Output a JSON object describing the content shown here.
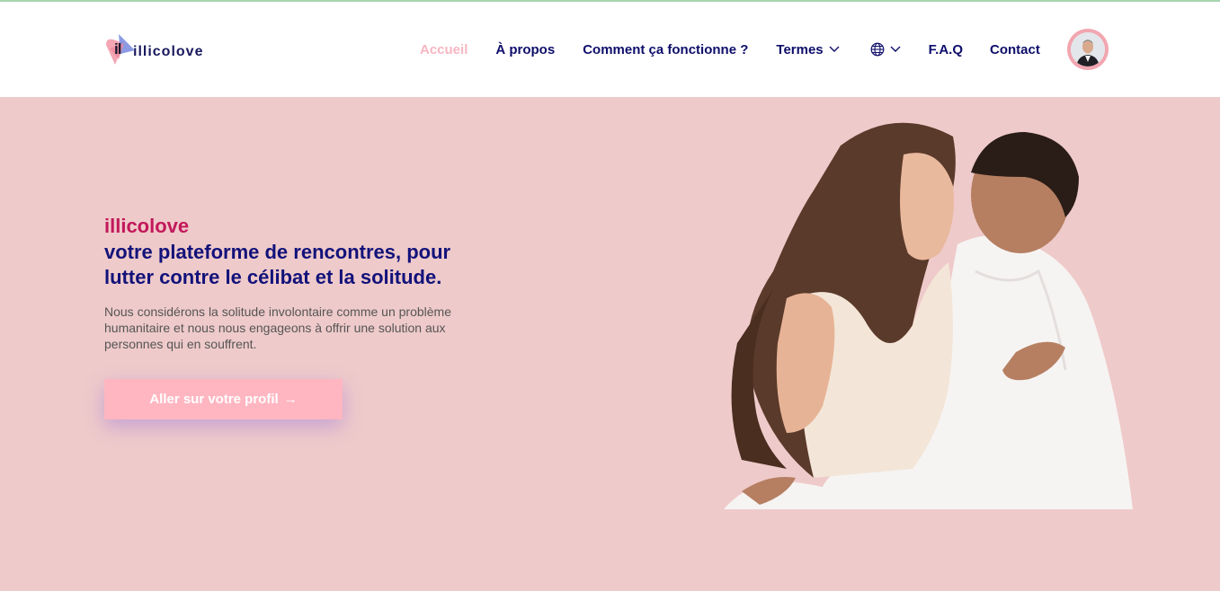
{
  "brand": {
    "logo_mark": "il",
    "logo_text": "illicolove",
    "colors": {
      "pink": "#f7b6c2",
      "navy": "#0e0e6b",
      "magenta": "#c2185b",
      "hero_bg": "#efcaca"
    }
  },
  "nav": {
    "items": [
      {
        "label": "Accueil",
        "active": true
      },
      {
        "label": "À propos"
      },
      {
        "label": "Comment ça fonctionne ?"
      },
      {
        "label": "Termes",
        "icon": "chevron-down-icon"
      },
      {
        "label": "",
        "icon": "globe-icon"
      },
      {
        "label": "F.A.Q"
      },
      {
        "label": "Contact"
      }
    ],
    "avatar_icon": "user-avatar"
  },
  "hero": {
    "brand": "illicolove",
    "headline": "votre plateforme de rencontres, pour lutter contre le célibat et la solitude.",
    "description": "Nous considérons la solitude involontaire comme un problème humanitaire et nous nous engageons à offrir une solution aux personnes qui en souffrent.",
    "cta_label": "Aller sur votre profil",
    "cta_icon": "arrow-right-icon",
    "image": "couple-photo"
  }
}
